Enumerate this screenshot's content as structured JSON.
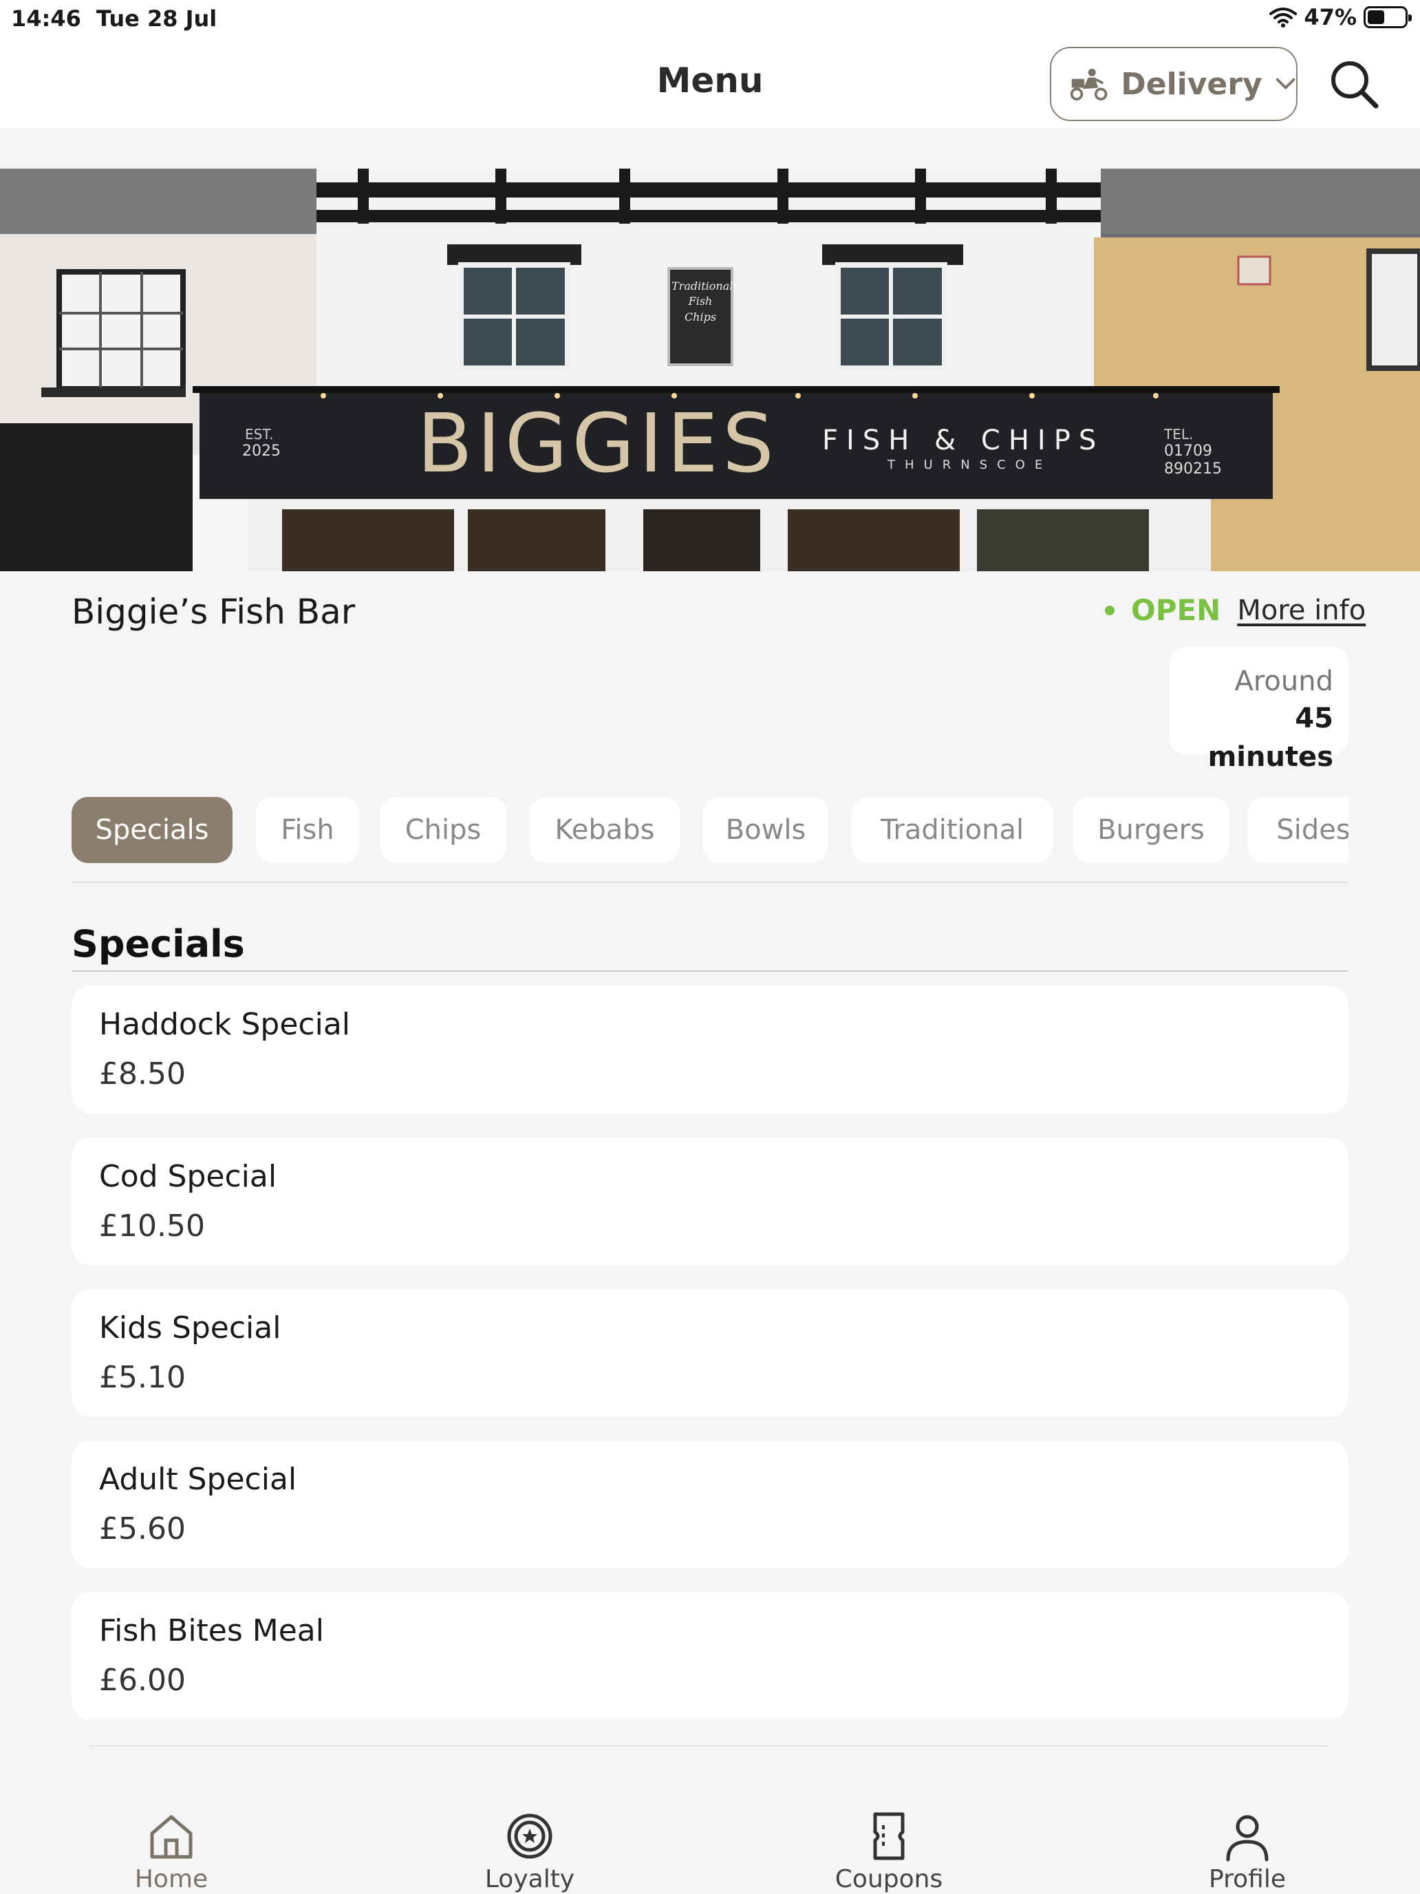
{
  "status_bar": {
    "time": "14:46",
    "date": "Tue 28 Jul",
    "battery_percent": "47%",
    "battery_level": 0.47
  },
  "header": {
    "title": "Menu",
    "delivery_label": "Delivery",
    "delivery_icon": "scooter-icon",
    "search_icon": "search-icon"
  },
  "hero": {
    "sign_name": "BIGGIES",
    "sign_est": "EST.",
    "sign_year": "2025",
    "sign_subtitle": "FISH & CHIPS",
    "sign_location": "THURNSCOE",
    "sign_tel_label": "TEL.",
    "sign_tel_1": "01709",
    "sign_tel_2": "890215",
    "chalkboard": "Traditional Fish Chips"
  },
  "restaurant": {
    "name": "Biggie’s Fish Bar",
    "status": "OPEN",
    "more_info": "More info",
    "eta_prefix": "Around",
    "eta_value": "45 minutes"
  },
  "tabs": [
    {
      "label": "Specials",
      "active": true
    },
    {
      "label": "Fish",
      "active": false
    },
    {
      "label": "Chips",
      "active": false
    },
    {
      "label": "Kebabs",
      "active": false
    },
    {
      "label": "Bowls",
      "active": false
    },
    {
      "label": "Traditional",
      "active": false
    },
    {
      "label": "Burgers",
      "active": false
    },
    {
      "label": "Sides",
      "active": false
    }
  ],
  "section": {
    "title": "Specials",
    "items": [
      {
        "name": "Haddock Special",
        "price": "£8.50"
      },
      {
        "name": "Cod Special",
        "price": "£10.50"
      },
      {
        "name": "Kids Special",
        "price": "£5.10"
      },
      {
        "name": "Adult Special",
        "price": "£5.60"
      },
      {
        "name": "Fish Bites Meal",
        "price": "£6.00"
      }
    ]
  },
  "bottom_nav": [
    {
      "label": "Home",
      "icon": "home-icon",
      "active": true
    },
    {
      "label": "Loyalty",
      "icon": "loyalty-icon",
      "active": false
    },
    {
      "label": "Coupons",
      "icon": "coupon-icon",
      "active": false
    },
    {
      "label": "Profile",
      "icon": "profile-icon",
      "active": false
    }
  ],
  "colors": {
    "accent": "#8a7d6e",
    "open_green": "#7ac143",
    "background": "#f5f5f5"
  }
}
